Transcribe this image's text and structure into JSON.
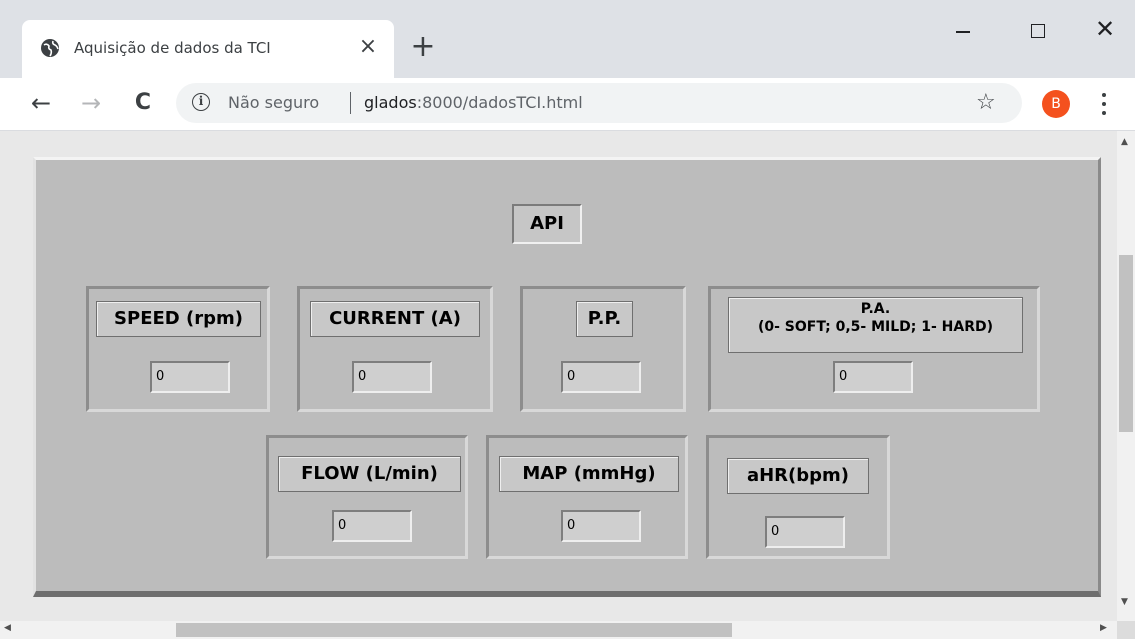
{
  "tab": {
    "title": "Aquisição de dados da TCI",
    "close": "×"
  },
  "window": {
    "new_tab": "+",
    "close": "✕"
  },
  "toolbar": {
    "back": "←",
    "forward": "→",
    "reload": "C",
    "security_label": "Não seguro",
    "url_host": "glados",
    "url_rest": ":8000/dadosTCI.html",
    "star": "☆",
    "avatar_initial": "B"
  },
  "panel": {
    "title": "API",
    "controls": [
      {
        "label": "SPEED (rpm)",
        "value": "0"
      },
      {
        "label": "CURRENT (A)",
        "value": "0"
      },
      {
        "label": "P.P.",
        "value": "0"
      },
      {
        "label": "P.A.",
        "label_line2": "(0- SOFT; 0,5- MILD; 1- HARD)",
        "value": "0"
      },
      {
        "label": "FLOW (L/min)",
        "value": "0"
      },
      {
        "label": "MAP (mmHg)",
        "value": "0"
      },
      {
        "label": "aHR(bpm)",
        "value": "0"
      }
    ]
  },
  "colors": {
    "panel_bg": "#bcbcbc",
    "avatar": "#f4511e"
  },
  "icons": [
    "globe-icon",
    "close-icon",
    "plus-icon",
    "minimize-icon",
    "maximize-icon",
    "back-icon",
    "forward-icon",
    "reload-icon",
    "info-icon",
    "star-icon",
    "menu-icon"
  ]
}
